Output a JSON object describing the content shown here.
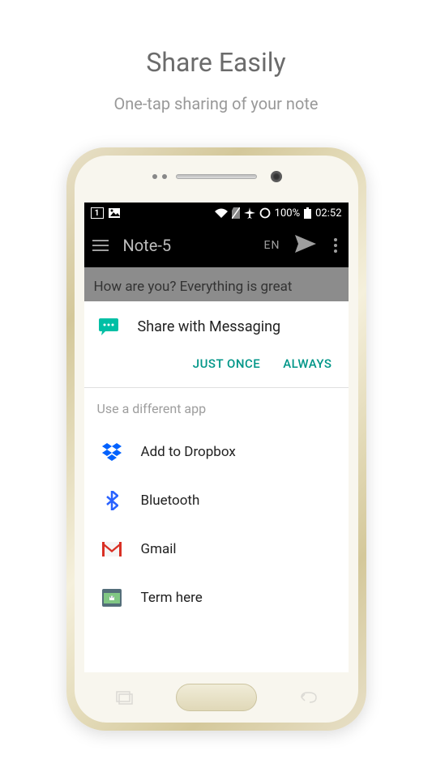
{
  "promo": {
    "title": "Share Easily",
    "subtitle": "One-tap sharing of your note"
  },
  "status_bar": {
    "sim_number": "1",
    "battery_percent": "100%",
    "time": "02:52"
  },
  "app_bar": {
    "title": "Note-5",
    "lang": "EN"
  },
  "note": {
    "content": "How are you? Everything is great"
  },
  "share_dialog": {
    "primary_title": "Share with Messaging",
    "just_once": "JUST ONCE",
    "always": "ALWAYS",
    "alt_label": "Use a different app",
    "apps": [
      {
        "name": "dropbox",
        "label": "Add to Dropbox"
      },
      {
        "name": "bluetooth",
        "label": "Bluetooth"
      },
      {
        "name": "gmail",
        "label": "Gmail"
      },
      {
        "name": "term",
        "label": "Term here"
      }
    ]
  }
}
